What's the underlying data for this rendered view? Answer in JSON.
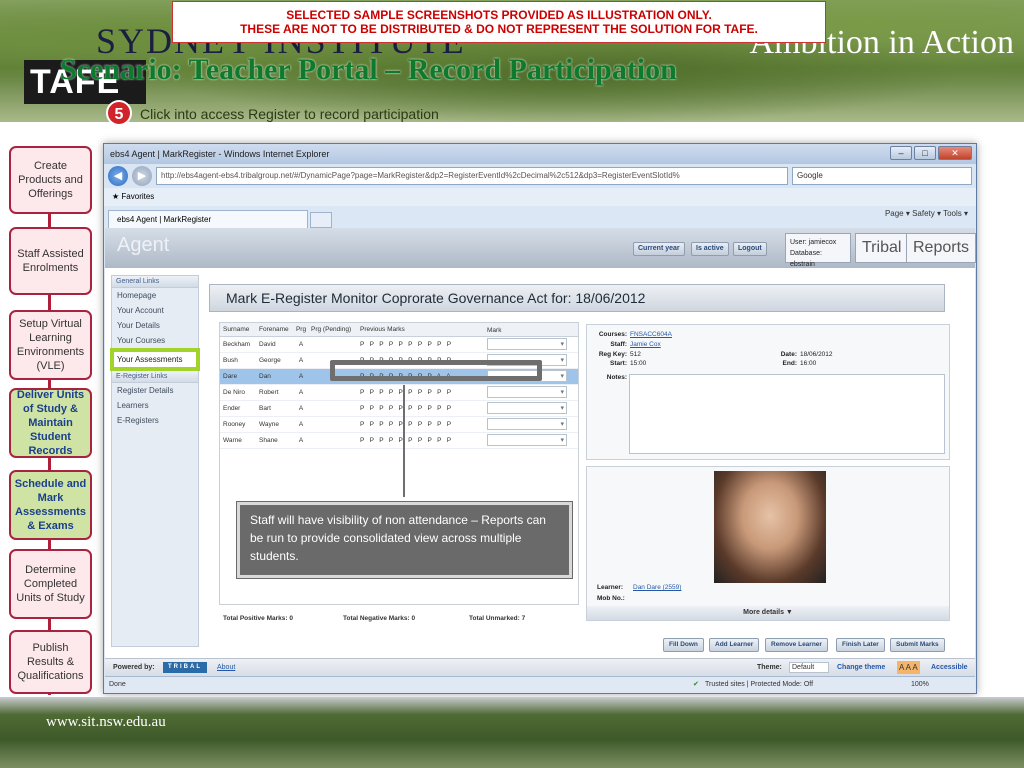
{
  "slide": {
    "warning_line1": "SELECTED SAMPLE SCREENSHOTS PROVIDED AS ILLUSTRATION ONLY.",
    "warning_line2": "THESE ARE NOT TO BE DISTRIBUTED & DO NOT REPRESENT THE SOLUTION FOR TAFE.",
    "institute": "SYDNEY INSTITUTE",
    "tagline": "Ambition in Action",
    "scenario": "Scenario: Teacher Portal – Record Participation",
    "logo": "TAFE",
    "step_number": "5",
    "step_text": "Click into access Register to record participation",
    "footer_url": "www.sit.nsw.edu.au",
    "callout": "Staff will have visibility of non attendance – Reports can be run to provide consolidated view across multiple students."
  },
  "process_nav": [
    {
      "label": "Create Products and Offerings",
      "active": false
    },
    {
      "label": "Staff Assisted Enrolments",
      "active": false
    },
    {
      "label": "Setup Virtual Learning Environments (VLE)",
      "active": false
    },
    {
      "label": "Deliver Units of Study & Maintain Student Records",
      "active": true
    },
    {
      "label": "Schedule and Mark Assessments & Exams",
      "active": true
    },
    {
      "label": "Determine Completed Units of Study",
      "active": false
    },
    {
      "label": "Publish Results & Qualifications",
      "active": false
    }
  ],
  "browser": {
    "title": "ebs4 Agent | MarkRegister - Windows Internet Explorer",
    "url": "http://ebs4agent-ebs4.tribalgroup.net/#/DynamicPage?page=MarkRegister&dp2=RegisterEventId%2cDecimal%2c512&dp3=RegisterEventSlotId%",
    "search_label": "Google",
    "favorites": "Favorites",
    "tab_label": "ebs4 Agent | MarkRegister",
    "toolbar_right": "Page ▾  Safety ▾  Tools ▾",
    "status_left": "Done",
    "status_right": "Trusted sites | Protected Mode: Off",
    "zoom": "100%"
  },
  "app": {
    "logo": "Agent",
    "btn_current_year": "Current year",
    "btn_is_active": "Is active",
    "btn_logout": "Logout",
    "user_line": "User: jamiecox",
    "db_line": "Database: ebstrain",
    "btn_tribal": "Tribal",
    "btn_reports": "Reports",
    "general_links_title": "General Links",
    "general_links": [
      "Homepage",
      "Your Account",
      "Your Details",
      "Your Courses",
      "Your Assessments"
    ],
    "eregister_links_title": "E-Register Links",
    "eregister_links": [
      "Register Details",
      "Learners",
      "E-Registers"
    ],
    "page_title": "Mark E-Register Monitor Coprorate Governance Act for: 18/06/2012",
    "grid_headers": {
      "surname": "Surname",
      "forename": "Forename",
      "prg": "Prg",
      "pending": "Prg (Pending)",
      "prev": "Previous Marks",
      "mark": "Mark"
    },
    "rows": [
      {
        "surname": "Beckham",
        "forename": "David",
        "prg": "A",
        "marks": "PPPPPPPPPP",
        "selected": false
      },
      {
        "surname": "Bush",
        "forename": "George",
        "prg": "A",
        "marks": "PPPPPPPPPP",
        "selected": false
      },
      {
        "surname": "Dare",
        "forename": "Dan",
        "prg": "A",
        "marks": "PPPPPPPPAA",
        "selected": true
      },
      {
        "surname": "De Niro",
        "forename": "Robert",
        "prg": "A",
        "marks": "PPPPPPPPPP",
        "selected": false
      },
      {
        "surname": "Ender",
        "forename": "Bart",
        "prg": "A",
        "marks": "PPPPPPPPPP",
        "selected": false
      },
      {
        "surname": "Rooney",
        "forename": "Wayne",
        "prg": "A",
        "marks": "PPPPPPPPPP",
        "selected": false
      },
      {
        "surname": "Warne",
        "forename": "Shane",
        "prg": "A",
        "marks": "PPPPPPPPPP",
        "selected": false
      }
    ],
    "details": {
      "courses_label": "Courses:",
      "courses": "FNSACC604A",
      "staff_label": "Staff:",
      "staff": "Jamie Cox",
      "regkey_label": "Reg Key:",
      "regkey": "512",
      "start_label": "Start:",
      "start": "15:00",
      "notes_label": "Notes:",
      "date_label": "Date:",
      "date": "18/06/2012",
      "end_label": "End:",
      "end": "16:00"
    },
    "learner_label": "Learner:",
    "learner": "Dan Dare (2559)",
    "mob_label": "Mob No.:",
    "more_details": "More details ▼",
    "totals": {
      "positive": "Total Positive Marks: 0",
      "negative": "Total Negative Marks: 0",
      "unmarked": "Total Unmarked: 7"
    },
    "actions": [
      "Fill Down",
      "Add Learner",
      "Remove Learner",
      "Finish Later",
      "Submit Marks"
    ],
    "powered_by": "Powered by:",
    "tribal_brand": "TRIBAL",
    "about": "About",
    "theme_label": "Theme:",
    "theme_value": "Default",
    "change_theme": "Change theme",
    "accessible": "Accessible"
  },
  "colors": {
    "accent_nav": "#a8233f",
    "highlight_green": "#a2d32a",
    "selected_row": "#9fc4ea"
  }
}
